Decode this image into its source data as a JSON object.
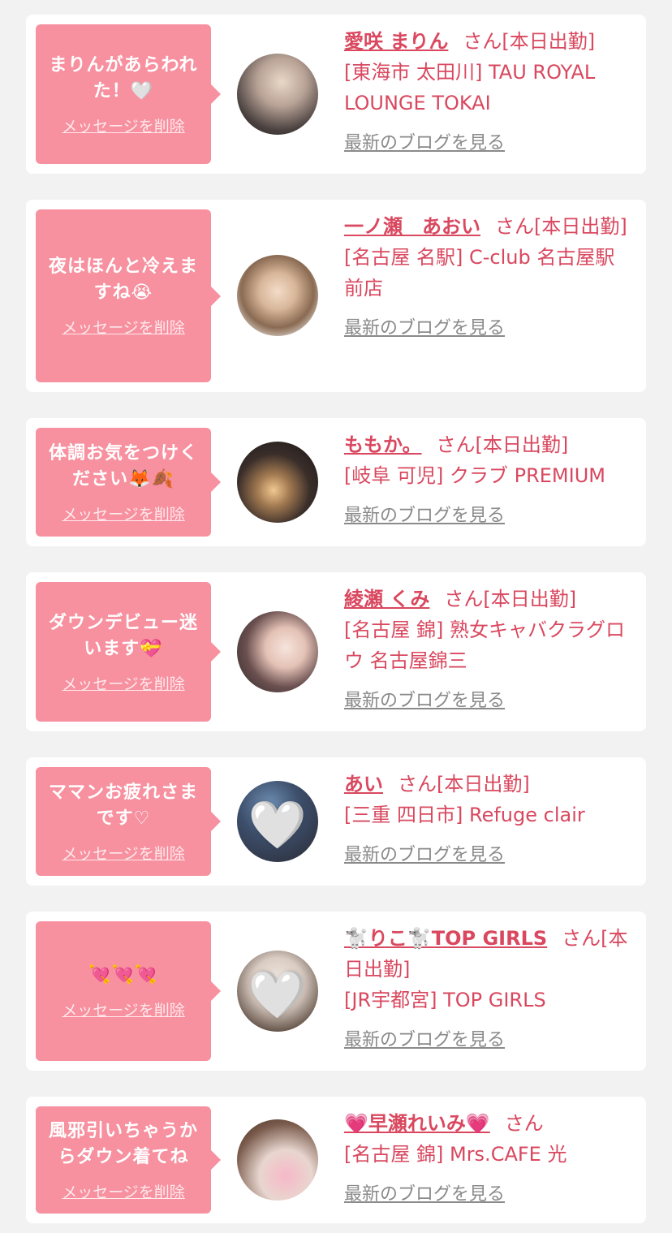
{
  "cards": [
    {
      "message": "まりんがあらわれた！🤍",
      "delete_label": "メッセージを削除",
      "name": "愛咲 まりん",
      "san": "さん",
      "status": "[本日出勤]",
      "store": "[東海市 太田川] TAU ROYAL LOUNGE TOKAI",
      "blog_label": "最新のブログを見る"
    },
    {
      "message": "夜はほんと冷えますね😭",
      "delete_label": "メッセージを削除",
      "name": "一ノ瀬　あおい",
      "san": "さん",
      "status": "[本日出勤]",
      "store": "[名古屋 名駅] C-club 名古屋駅前店",
      "blog_label": "最新のブログを見る"
    },
    {
      "message": "体調お気をつけください🦊🍂",
      "delete_label": "メッセージを削除",
      "name": "ももか。",
      "san": "さん",
      "status": "[本日出勤]",
      "store": "[岐阜 可児] クラブ PREMIUM",
      "blog_label": "最新のブログを見る"
    },
    {
      "message": "ダウンデビュー迷います💝",
      "delete_label": "メッセージを削除",
      "name": "綾瀬 くみ",
      "san": "さん",
      "status": "[本日出勤]",
      "store": "[名古屋 錦] 熟女キャバクラグロウ 名古屋錦三",
      "blog_label": "最新のブログを見る"
    },
    {
      "message": "ママンお疲れさまです♡",
      "delete_label": "メッセージを削除",
      "name": "あい",
      "san": "さん",
      "status": "[本日出勤]",
      "store": "[三重 四日市] Refuge clair",
      "blog_label": "最新のブログを見る"
    },
    {
      "message": "💘💘💘",
      "delete_label": "メッセージを削除",
      "name": "🐩りこ🐩TOP GIRLS",
      "san": "さん",
      "status": "[本日出勤]",
      "store": "[JR宇都宮] TOP GIRLS",
      "blog_label": "最新のブログを見る"
    },
    {
      "message": "風邪引いちゃうからダウン着てね",
      "delete_label": "メッセージを削除",
      "name": "💗早瀬れいみ💗",
      "san": "さん",
      "status": "",
      "store": "[名古屋 錦] Mrs.CAFE 光",
      "blog_label": "最新のブログを見る"
    }
  ],
  "colors": {
    "page_background": "#f2f2f2",
    "bubble": "#f7909f",
    "accent_text": "#d9485f",
    "link_gray": "#8a8a8a"
  },
  "icons": {
    "avatar_heart": "🤍"
  }
}
